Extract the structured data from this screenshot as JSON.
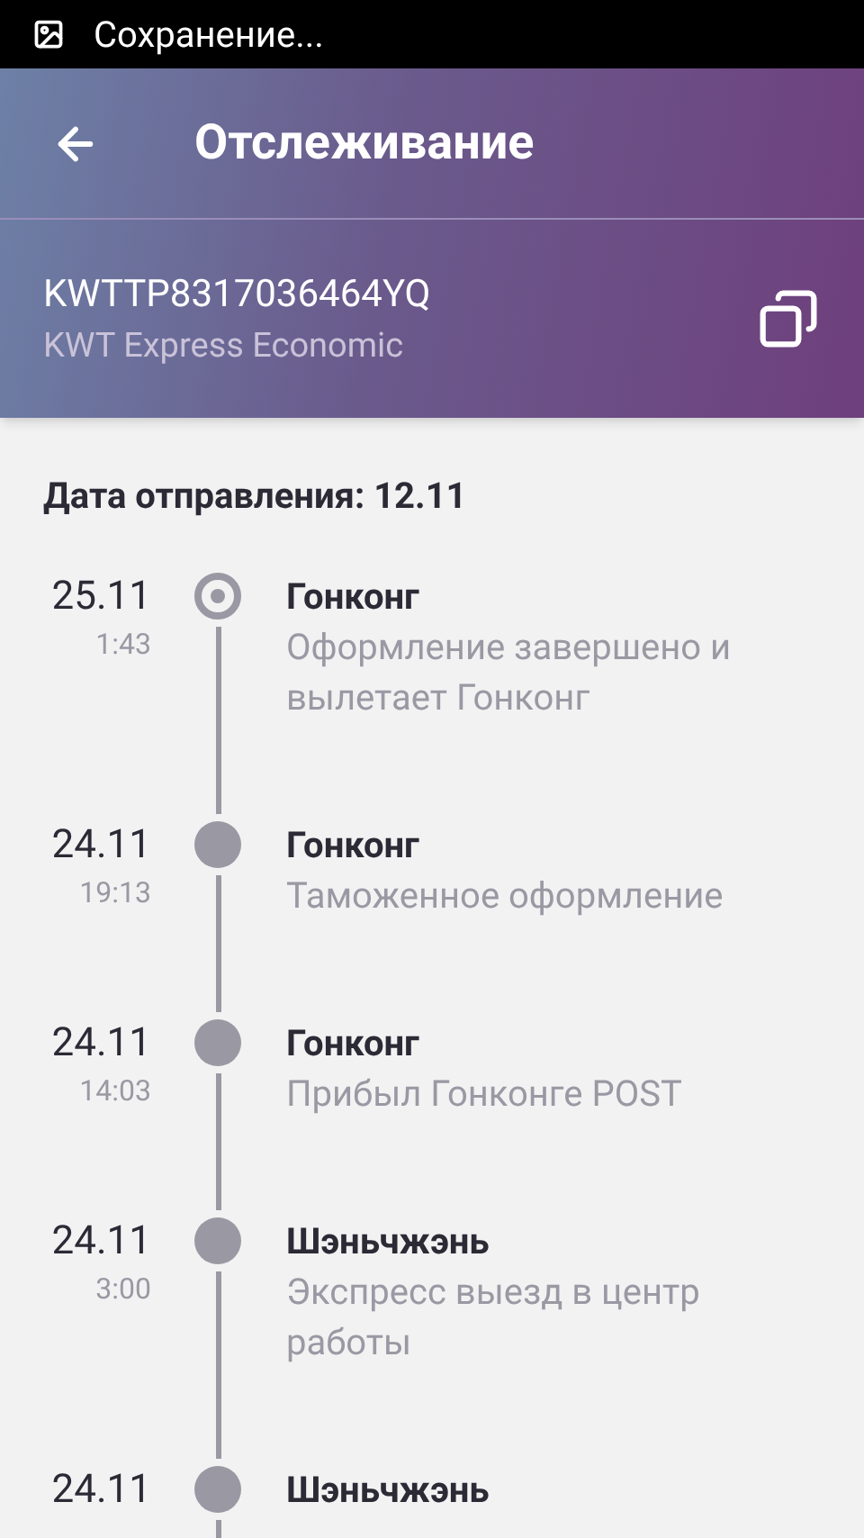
{
  "status_bar": {
    "text": "Сохранение..."
  },
  "toolbar": {
    "title": "Отслеживание"
  },
  "parcel": {
    "tracking_number": "KWTTP8317036464YQ",
    "service": "KWT Express Economic"
  },
  "departure": "Дата отправления: 12.11",
  "events": [
    {
      "date": "25.11",
      "time": "1:43",
      "place": "Гонконг",
      "description": "Оформление завершено и вылетает Гонконг",
      "current": true
    },
    {
      "date": "24.11",
      "time": "19:13",
      "place": "Гонконг",
      "description": "Таможенное оформление",
      "current": false
    },
    {
      "date": "24.11",
      "time": "14:03",
      "place": "Гонконг",
      "description": "Прибыл Гонконге POST",
      "current": false
    },
    {
      "date": "24.11",
      "time": "3:00",
      "place": "Шэньчжэнь",
      "description": "Экспресс выезд в центр работы",
      "current": false
    },
    {
      "date": "24.11",
      "place": "Шэньчжэнь",
      "current": false
    }
  ]
}
